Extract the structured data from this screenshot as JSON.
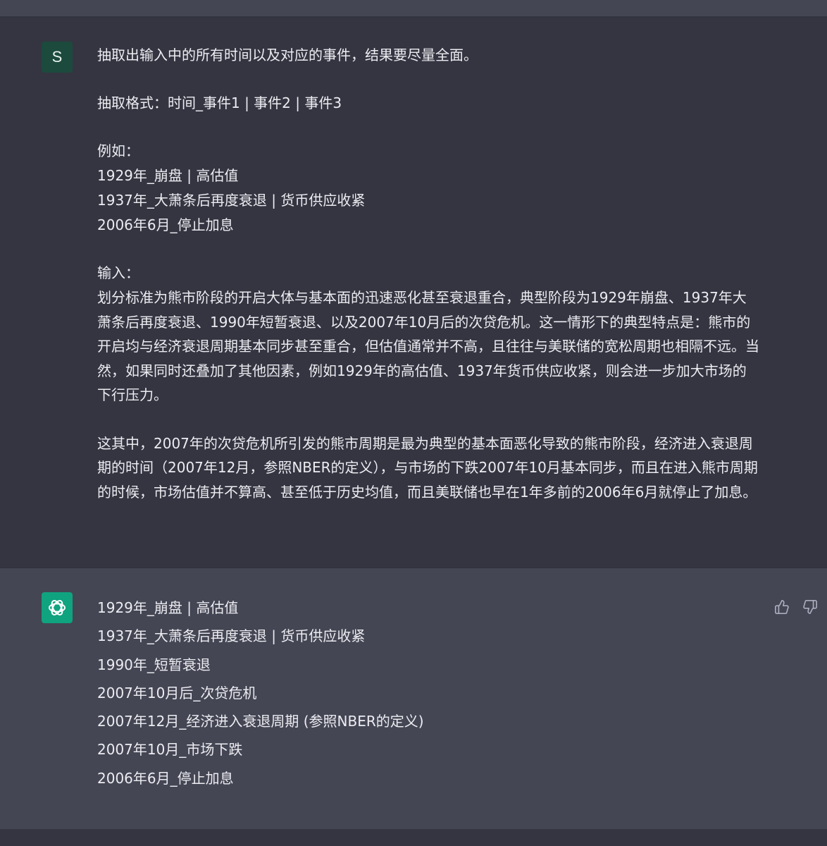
{
  "user_message": {
    "avatar_letter": "S",
    "lines": [
      "抽取出输入中的所有时间以及对应的事件，结果要尽量全面。",
      "",
      "抽取格式：时间_事件1 | 事件2 | 事件3",
      "",
      "例如：",
      "1929年_崩盘 | 高估值",
      "1937年_大萧条后再度衰退 | 货币供应收紧",
      "2006年6月_停止加息",
      "",
      "输入："
    ],
    "paragraph_1": "划分标准为熊市阶段的开启大体与基本面的迅速恶化甚至衰退重合，典型阶段为1929年崩盘、1937年大萧条后再度衰退、1990年短暂衰退、以及2007年10月后的次贷危机。这一情形下的典型特点是：熊市的开启均与经济衰退周期基本同步甚至重合，但估值通常并不高，且往往与美联储的宽松周期也相隔不远。当然，如果同时还叠加了其他因素，例如1929年的高估值、1937年货币供应收紧，则会进一步加大市场的下行压力。",
    "paragraph_2": "这其中，2007年的次贷危机所引发的熊市周期是最为典型的基本面恶化导致的熊市阶段，经济进入衰退周期的时间（2007年12月，参照NBER的定义），与市场的下跌2007年10月基本同步，而且在进入熊市周期的时候，市场估值并不算高、甚至低于历史均值，而且美联储也早在1年多前的2006年6月就停止了加息。"
  },
  "assistant_message": {
    "avatar_icon": "openai-logo-icon",
    "lines": [
      "1929年_崩盘 | 高估值",
      "1937年_大萧条后再度衰退 | 货币供应收紧",
      "1990年_短暂衰退",
      "2007年10月后_次贷危机",
      "2007年12月_经济进入衰退周期 (参照NBER的定义)",
      "2007年10月_市场下跌",
      "2006年6月_停止加息"
    ],
    "feedback_icons": [
      "thumbs-up-icon",
      "thumbs-down-icon"
    ]
  },
  "colors": {
    "page_bg": "#343541",
    "assistant_bg": "#444654",
    "user_avatar_bg": "#1c4a3c",
    "assistant_avatar_bg": "#10a37f",
    "text": "#ececf1",
    "icon": "#acacbe"
  }
}
